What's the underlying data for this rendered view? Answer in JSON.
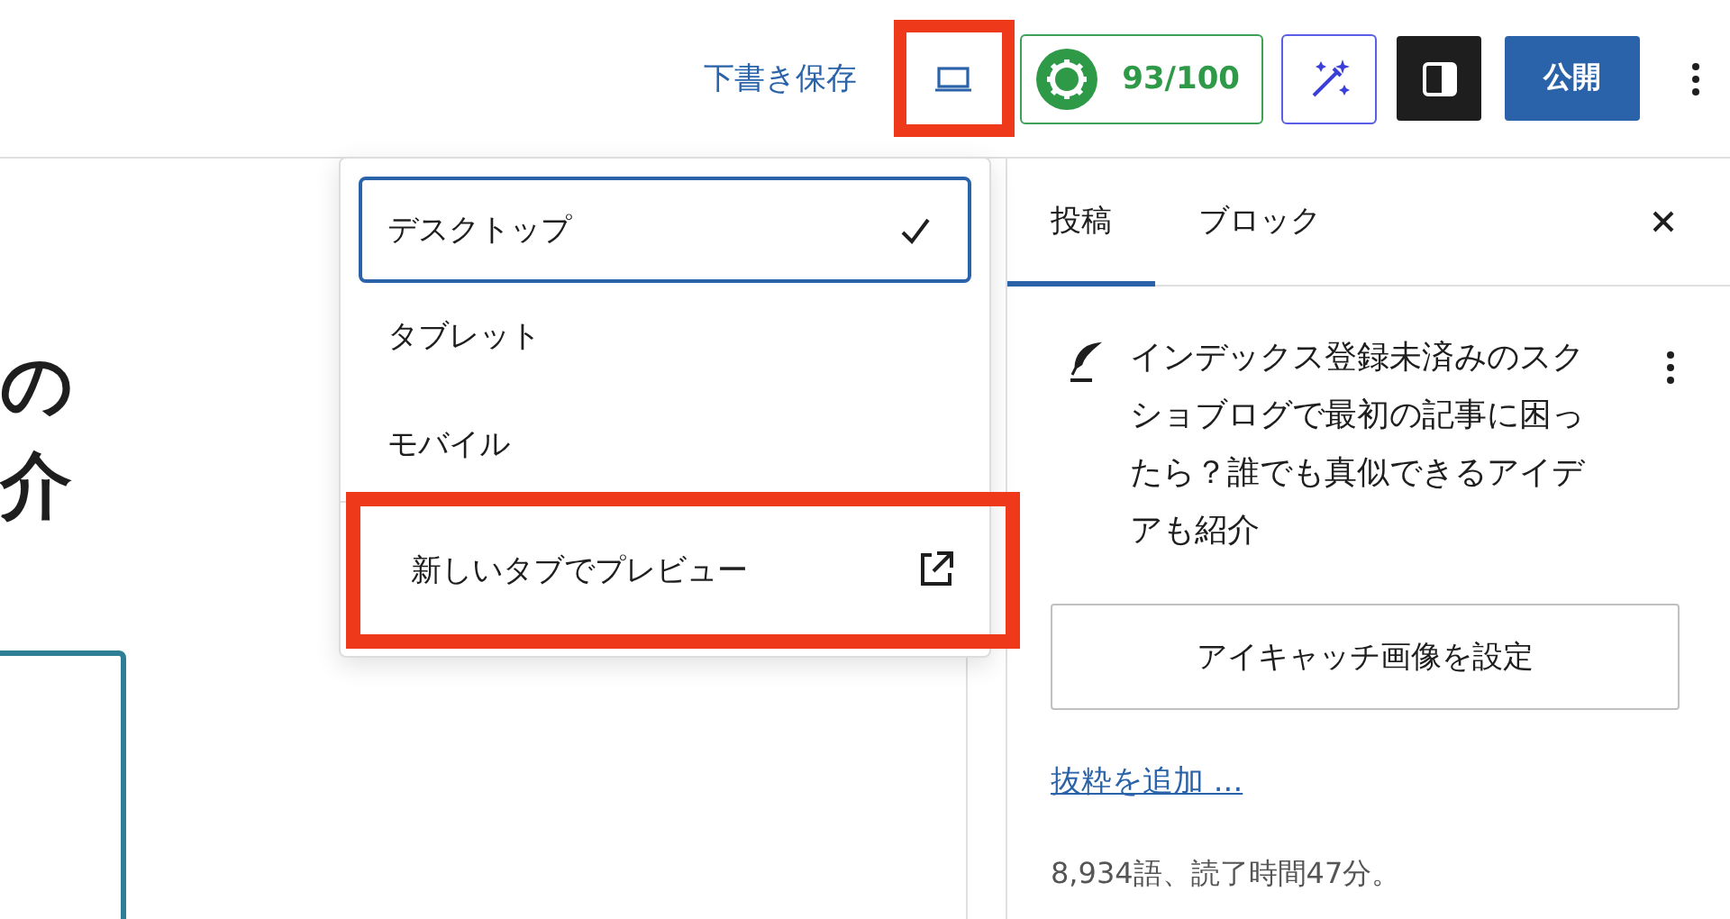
{
  "toolbar": {
    "save_draft": "下書き保存",
    "preview_button": {
      "highlighted": true
    },
    "score": "93/100",
    "publish": "公開"
  },
  "editor": {
    "heading_lines": [
      "の",
      "介"
    ]
  },
  "preview_menu": {
    "devices": [
      {
        "label": "デスクトップ",
        "selected": true
      },
      {
        "label": "タブレット",
        "selected": false
      },
      {
        "label": "モバイル",
        "selected": false
      }
    ],
    "new_tab": {
      "label": "新しいタブでプレビュー",
      "highlighted": true
    }
  },
  "sidebar": {
    "tabs": [
      {
        "label": "投稿",
        "selected": true
      },
      {
        "label": "ブロック",
        "selected": false
      }
    ],
    "post_title": "インデックス登録未済みのスクショブログで最初の記事に困ったら？誰でも真似できるアイデアも紹介",
    "featured_image_button": "アイキャッチ画像を設定",
    "excerpt_link": "抜粋を追加 ...",
    "stats": "8,934語、読了時間47分。"
  }
}
